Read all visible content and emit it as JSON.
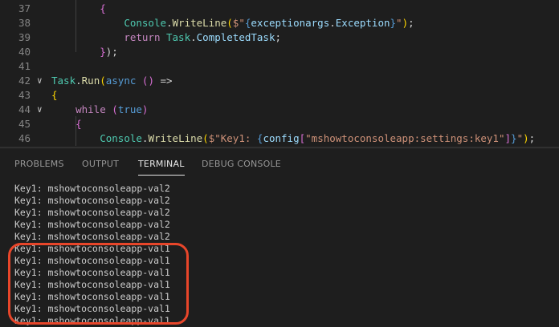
{
  "editor": {
    "lines": [
      {
        "n": "37",
        "fold": "",
        "tokens": [
          [
            "        ",
            "t-p"
          ],
          [
            "{",
            "t-pk"
          ]
        ]
      },
      {
        "n": "38",
        "fold": "",
        "tokens": [
          [
            "            ",
            "t-p"
          ],
          [
            "Console",
            "t-type"
          ],
          [
            ".",
            "t-p"
          ],
          [
            "WriteLine",
            "t-method"
          ],
          [
            "(",
            "t-y"
          ],
          [
            "$\"",
            "t-str"
          ],
          [
            "{",
            "t-brace"
          ],
          [
            "exceptionargs",
            "t-var"
          ],
          [
            ".",
            "t-p"
          ],
          [
            "Exception",
            "t-var"
          ],
          [
            "}",
            "t-brace"
          ],
          [
            "\"",
            "t-str"
          ],
          [
            ")",
            "t-y"
          ],
          [
            ";",
            "t-p"
          ]
        ]
      },
      {
        "n": "39",
        "fold": "",
        "tokens": [
          [
            "            ",
            "t-p"
          ],
          [
            "return",
            "t-kw"
          ],
          [
            " ",
            "t-p"
          ],
          [
            "Task",
            "t-type"
          ],
          [
            ".",
            "t-p"
          ],
          [
            "CompletedTask",
            "t-var"
          ],
          [
            ";",
            "t-p"
          ]
        ]
      },
      {
        "n": "40",
        "fold": "",
        "tokens": [
          [
            "        ",
            "t-p"
          ],
          [
            "}",
            "t-pk"
          ],
          [
            ");",
            "t-p"
          ]
        ]
      },
      {
        "n": "41",
        "fold": "",
        "tokens": []
      },
      {
        "n": "42",
        "fold": "∨",
        "tokens": [
          [
            "Task",
            "t-type"
          ],
          [
            ".",
            "t-p"
          ],
          [
            "Run",
            "t-method"
          ],
          [
            "(",
            "t-y"
          ],
          [
            "async",
            "t-kwb"
          ],
          [
            " ",
            "t-p"
          ],
          [
            "()",
            "t-pk"
          ],
          [
            " =>",
            "t-p"
          ]
        ]
      },
      {
        "n": "43",
        "fold": "",
        "tokens": [
          [
            "{",
            "t-y"
          ]
        ]
      },
      {
        "n": "44",
        "fold": "∨",
        "tokens": [
          [
            "    ",
            "t-p"
          ],
          [
            "while",
            "t-kw"
          ],
          [
            " ",
            "t-p"
          ],
          [
            "(",
            "t-pk"
          ],
          [
            "true",
            "t-kwb"
          ],
          [
            ")",
            "t-pk"
          ]
        ]
      },
      {
        "n": "45",
        "fold": "",
        "tokens": [
          [
            "    ",
            "t-p"
          ],
          [
            "{",
            "t-pk"
          ]
        ]
      },
      {
        "n": "46",
        "fold": "",
        "tokens": [
          [
            "        ",
            "t-p"
          ],
          [
            "Console",
            "t-type"
          ],
          [
            ".",
            "t-p"
          ],
          [
            "WriteLine",
            "t-method"
          ],
          [
            "(",
            "t-y"
          ],
          [
            "$\"Key1: ",
            "t-str"
          ],
          [
            "{",
            "t-brace"
          ],
          [
            "config",
            "t-var"
          ],
          [
            "[",
            "t-pk"
          ],
          [
            "\"mshowtoconsoleapp:settings:key1\"",
            "t-str"
          ],
          [
            "]",
            "t-pk"
          ],
          [
            "}",
            "t-brace"
          ],
          [
            "\"",
            "t-str"
          ],
          [
            ")",
            "t-y"
          ],
          [
            ";",
            "t-p"
          ]
        ]
      },
      {
        "n": "47",
        "fold": "",
        "tokens": []
      }
    ]
  },
  "panel": {
    "tabs": [
      {
        "label": "PROBLEMS",
        "active": false
      },
      {
        "label": "OUTPUT",
        "active": false
      },
      {
        "label": "TERMINAL",
        "active": true
      },
      {
        "label": "DEBUG CONSOLE",
        "active": false
      }
    ]
  },
  "terminal": {
    "lines": [
      "Key1: mshowtoconsoleapp-val2",
      "Key1: mshowtoconsoleapp-val2",
      "Key1: mshowtoconsoleapp-val2",
      "Key1: mshowtoconsoleapp-val2",
      "Key1: mshowtoconsoleapp-val2",
      "Key1: mshowtoconsoleapp-val1",
      "Key1: mshowtoconsoleapp-val1",
      "Key1: mshowtoconsoleapp-val1",
      "Key1: mshowtoconsoleapp-val1",
      "Key1: mshowtoconsoleapp-val1",
      "Key1: mshowtoconsoleapp-val1",
      "Key1: mshowtoconsoleapp-val1"
    ]
  },
  "colors": {
    "highlight": "#e8462a",
    "background": "#1e1e1e"
  }
}
